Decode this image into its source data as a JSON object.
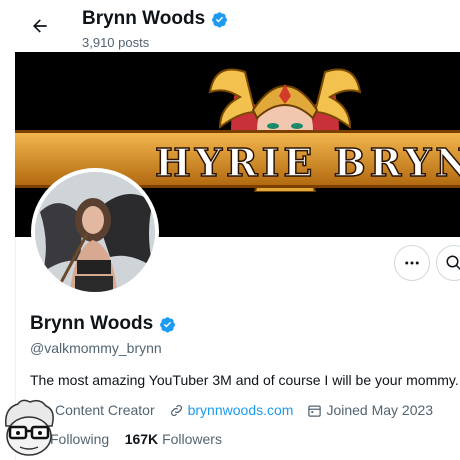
{
  "header": {
    "name": "Brynn Woods",
    "posts": "3,910 posts"
  },
  "banner": {
    "text": "HYRIE BRYN"
  },
  "profile": {
    "name": "Brynn Woods",
    "handle": "@valkmommy_brynn",
    "bio": "The most amazing YouTuber 3M and of course I will be your mommy.",
    "category": "Content Creator",
    "website": "brynnwoods.com",
    "joined": "Joined May 2023",
    "following_label": "Following",
    "followers_count": "167K",
    "followers_label": "Followers"
  },
  "icons": {
    "back": "arrow-left-icon",
    "verified": "verified-badge-icon",
    "more": "more-dots-icon",
    "search": "search-icon",
    "category": "briefcase-icon",
    "link": "link-icon",
    "calendar": "calendar-icon"
  },
  "colors": {
    "accent": "#1d9bf0",
    "text": "#0f1419",
    "secondary": "#536471",
    "banner_bg": "#000000",
    "ribbon_gold": "#f2b64d"
  }
}
